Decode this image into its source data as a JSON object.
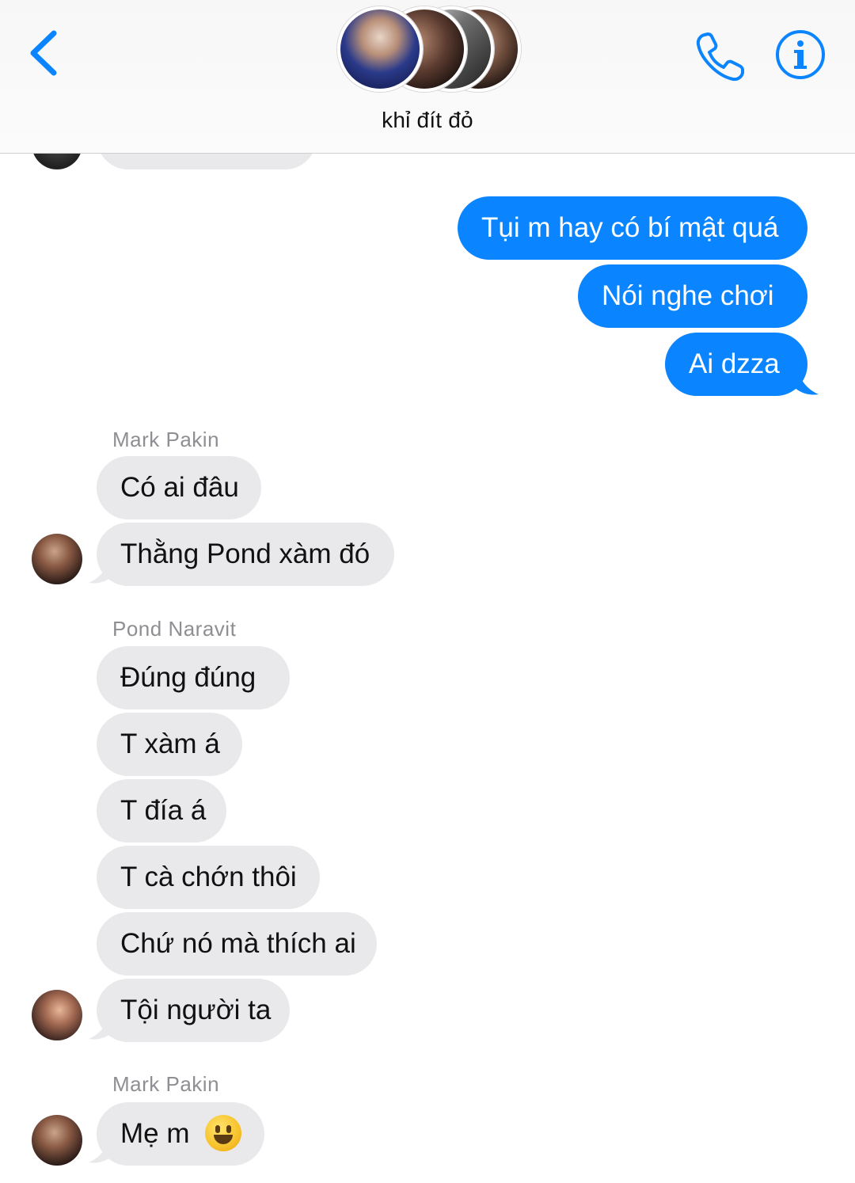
{
  "header": {
    "group_name": "khỉ đít đỏ",
    "accent_color": "#0a84ff"
  },
  "icons": {
    "back": "chevron-left-icon",
    "call": "phone-icon",
    "info": "info-icon"
  },
  "messages": {
    "outgoing": [
      "Tụi m hay có bí mật quá",
      "Nói nghe chơi",
      "Ai dzza"
    ],
    "group1": {
      "sender": "Mark Pakin",
      "texts": [
        "Có ai đâu",
        "Thằng Pond xàm đó"
      ]
    },
    "group2": {
      "sender": "Pond Naravit",
      "texts": [
        "Đúng đúng",
        "T xàm á",
        "T đía á",
        "T cà chớn thôi",
        "Chứ nó mà thích ai",
        "Tội người ta"
      ]
    },
    "group3": {
      "sender": "Mark Pakin",
      "text": "Mẹ m",
      "emoji": "grinning-face"
    }
  },
  "colors": {
    "outgoing_bubble": "#0a84ff",
    "incoming_bubble": "#e9e9eb",
    "sender_name": "#8e8e93"
  }
}
